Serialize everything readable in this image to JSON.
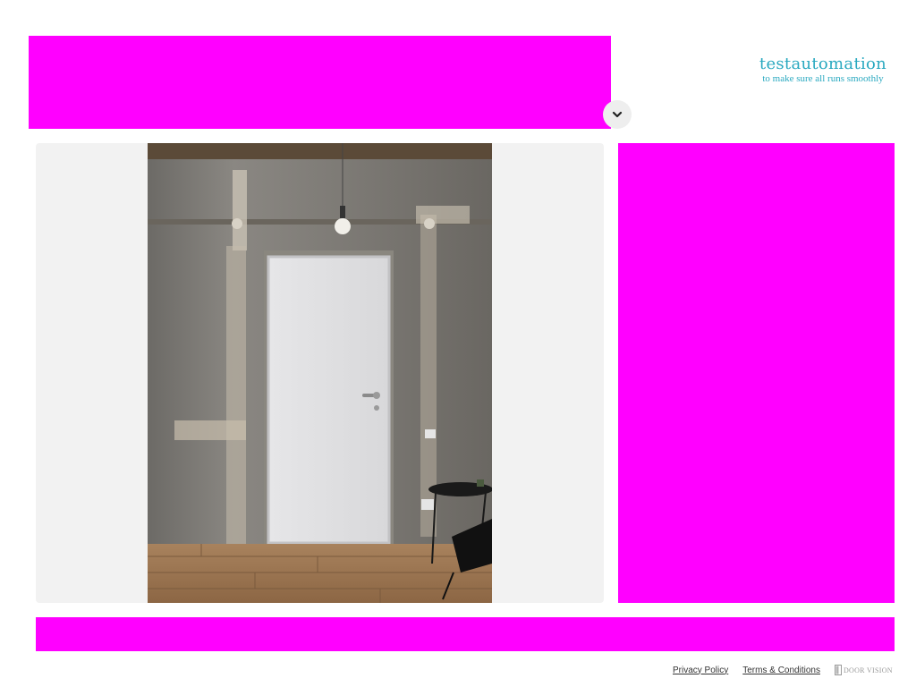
{
  "header": {
    "brand_name": "testautomation",
    "brand_tagline": "to make sure all runs smoothly"
  },
  "preview": {
    "icons": [
      "chevron-down-icon"
    ]
  },
  "footer": {
    "privacy_label": "Privacy Policy",
    "terms_label": "Terms & Conditions",
    "powered_by_logo_text": "DOOR VISION"
  },
  "colors": {
    "brand": "#2aa9c0",
    "placeholder_block": "#ff00ff",
    "preview_bg": "#f2f2f2"
  }
}
